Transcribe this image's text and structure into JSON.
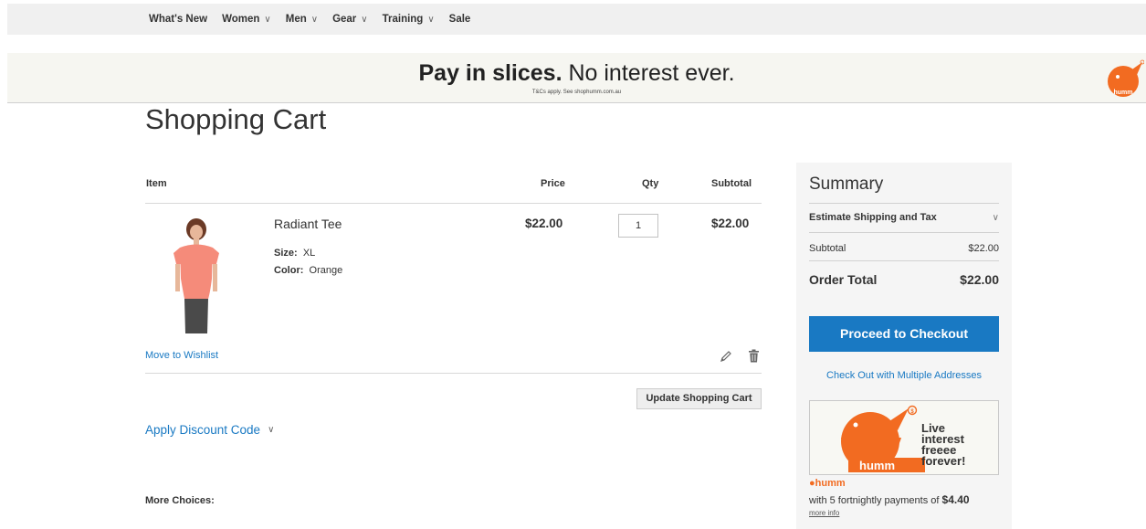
{
  "nav": {
    "items": [
      {
        "label": "What's New",
        "has_dropdown": false
      },
      {
        "label": "Women",
        "has_dropdown": true
      },
      {
        "label": "Men",
        "has_dropdown": true
      },
      {
        "label": "Gear",
        "has_dropdown": true
      },
      {
        "label": "Training",
        "has_dropdown": true
      },
      {
        "label": "Sale",
        "has_dropdown": false
      }
    ]
  },
  "banner": {
    "headline_bold": "Pay in slices.",
    "headline_rest": " No interest ever.",
    "fineprint": "T&Cs apply. See shophumm.com.au",
    "logo_text": "humm"
  },
  "page": {
    "title": "Shopping Cart"
  },
  "cart": {
    "columns": {
      "item": "Item",
      "price": "Price",
      "qty": "Qty",
      "subtotal": "Subtotal"
    },
    "items": [
      {
        "name": "Radiant Tee",
        "options": [
          {
            "label": "Size:",
            "value": "XL"
          },
          {
            "label": "Color:",
            "value": "Orange"
          }
        ],
        "price": "$22.00",
        "qty": "1",
        "subtotal": "$22.00"
      }
    ],
    "move_to_wishlist": "Move to Wishlist",
    "update_button": "Update Shopping Cart",
    "discount_label": "Apply Discount Code",
    "more_choices": "More Choices:"
  },
  "summary": {
    "title": "Summary",
    "estimate_label": "Estimate Shipping and Tax",
    "subtotal_label": "Subtotal",
    "subtotal_value": "$22.00",
    "order_total_label": "Order Total",
    "order_total_value": "$22.00",
    "checkout_button": "Proceed to Checkout",
    "multi_address_link": "Check Out with Multiple Addresses",
    "ad": {
      "lines": [
        "Live",
        "interest",
        "freeee",
        "forever!"
      ],
      "logo_text": "humm"
    },
    "humm_brand": "humm",
    "installments_text": "with 5 fortnightly payments of ",
    "installments_amount": "$4.40",
    "more_info": "more info"
  },
  "colors": {
    "accent_blue": "#1979c3",
    "humm_orange": "#f26b21",
    "nav_bg": "#f0f0f0",
    "summary_bg": "#f5f5f5"
  }
}
